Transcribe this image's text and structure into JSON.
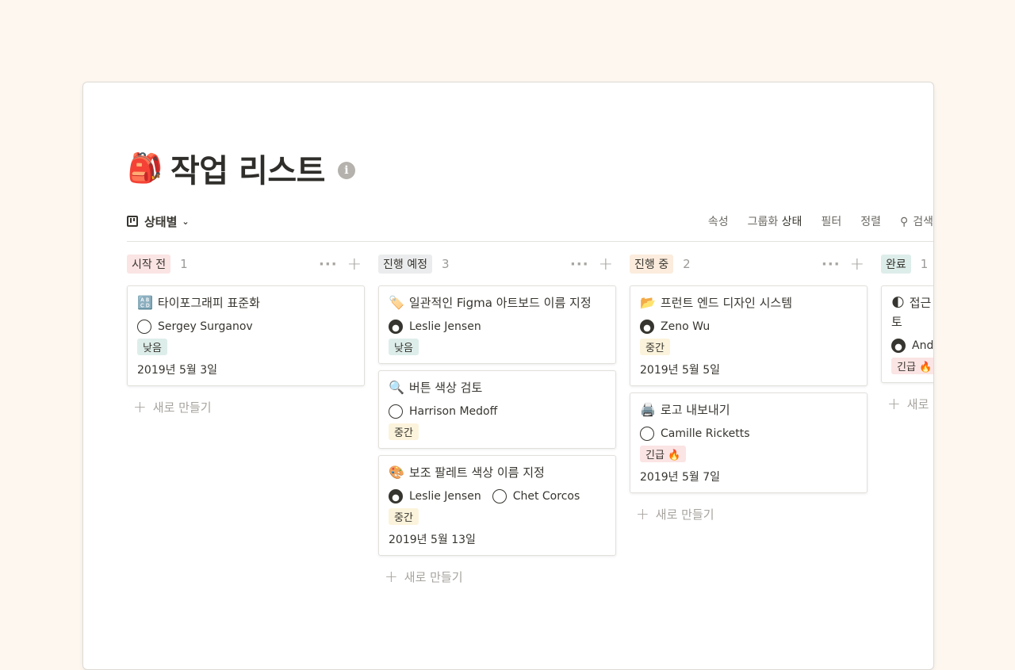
{
  "page": {
    "icon": "backpack-icon",
    "icon_glyph": "🎒",
    "title": "작업 리스트",
    "info_glyph": "i"
  },
  "toolbar": {
    "view_label": "상태별",
    "properties": "속성",
    "group_prefix": "그룹화",
    "group_value": "상태",
    "filter": "필터",
    "sort": "정렬",
    "search": "검색"
  },
  "colors": {
    "not_started": "#fbe4e4",
    "planned": "#ebeced",
    "in_progress": "#fbecdd",
    "done": "#ddedea",
    "low": "#ddedea",
    "medium": "#fbf3db",
    "urgent": "#fbe4e4"
  },
  "columns": [
    {
      "status": "시작 전",
      "count": "1",
      "cards": [
        {
          "emoji": "🔠",
          "title": "타이포그래피 표준화",
          "people": [
            "Sergey Surganov"
          ],
          "priority": "낮음",
          "date": "2019년 5월 3일"
        }
      ],
      "new_label": "새로 만들기"
    },
    {
      "status": "진행 예정",
      "count": "3",
      "cards": [
        {
          "emoji": "🏷️",
          "title": "일관적인 Figma 아트보드 이름 지정",
          "people": [
            "Leslie Jensen"
          ],
          "priority": "낮음"
        },
        {
          "emoji": "🔍",
          "title": "버튼 색상 검토",
          "people": [
            "Harrison Medoff"
          ],
          "priority": "중간"
        },
        {
          "emoji": "🎨",
          "title": "보조 팔레트 색상 이름 지정",
          "people": [
            "Leslie Jensen",
            "Chet Corcos"
          ],
          "priority": "중간",
          "date": "2019년 5월 13일"
        }
      ],
      "new_label": "새로 만들기"
    },
    {
      "status": "진행 중",
      "count": "2",
      "cards": [
        {
          "emoji": "📂",
          "title": "프런트 엔드 디자인 시스템",
          "people": [
            "Zeno Wu"
          ],
          "priority": "중간",
          "date": "2019년 5월 5일"
        },
        {
          "emoji": "🖨️",
          "title": "로고 내보내기",
          "people": [
            "Camille Ricketts"
          ],
          "priority": "긴급 🔥",
          "date": "2019년 5월 7일"
        }
      ],
      "new_label": "새로 만들기"
    },
    {
      "status": "완료",
      "count": "1",
      "cards": [
        {
          "emoji": "🌓",
          "title": "접근",
          "title2": "토",
          "people": [
            "Andi"
          ],
          "priority": "긴급 🔥"
        }
      ],
      "new_label": "새로"
    }
  ]
}
